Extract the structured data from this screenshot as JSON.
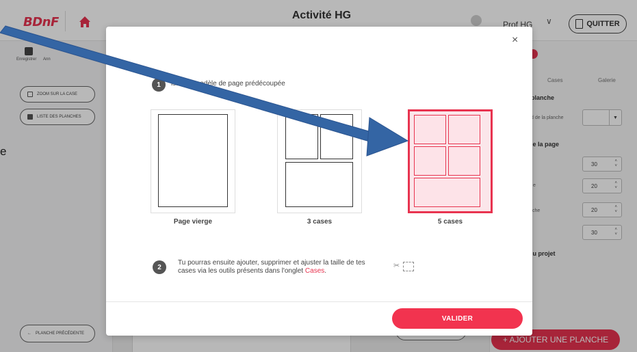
{
  "app": {
    "logo": "BDnF",
    "title": "Activité HG",
    "user_name": "Prof HG",
    "quit_label": "QUITTER"
  },
  "toolbar": {
    "save_label": "Enregistrer",
    "undo_label": "Ann"
  },
  "left_panel": {
    "zoom_label": "ZOOM SUR LA CASE",
    "list_label": "LISTE DES PLANCHES",
    "prev_label": "PLANCHE PRÉCÉDENTE"
  },
  "right_panel": {
    "tab_cases": "Cases",
    "tab_galerie": "Galerie",
    "section_planche": "planche",
    "bg_label": "d de la planche",
    "section_page": "le la page",
    "row_labels": [
      "",
      "e",
      "che",
      ""
    ],
    "stepper_values": [
      "30",
      "20",
      "20",
      "30"
    ],
    "section_projet": "lu projet",
    "add_page_label": "+ AJOUTER UNE PLANCHE"
  },
  "modal": {
    "step1_num": "1",
    "step1_text": "isis ton modèle de page prédécoupée",
    "templates": [
      {
        "label": "Page vierge",
        "selected": false
      },
      {
        "label": "3 cases",
        "selected": false
      },
      {
        "label": "5 cases",
        "selected": true
      }
    ],
    "step2_num": "2",
    "step2_text": "Tu pourras ensuite ajouter, supprimer et ajuster la taille de tes cases via les outils présents dans l'onglet ",
    "step2_link": "Cases",
    "step2_end": ".",
    "close_icon": "×",
    "validate_label": "VALIDER"
  },
  "annotation": {
    "stray_letter": "e",
    "arrow_color": "#3465a4"
  },
  "colors": {
    "accent": "#e8334f",
    "overlay": "rgba(0,0,0,0.28)"
  }
}
